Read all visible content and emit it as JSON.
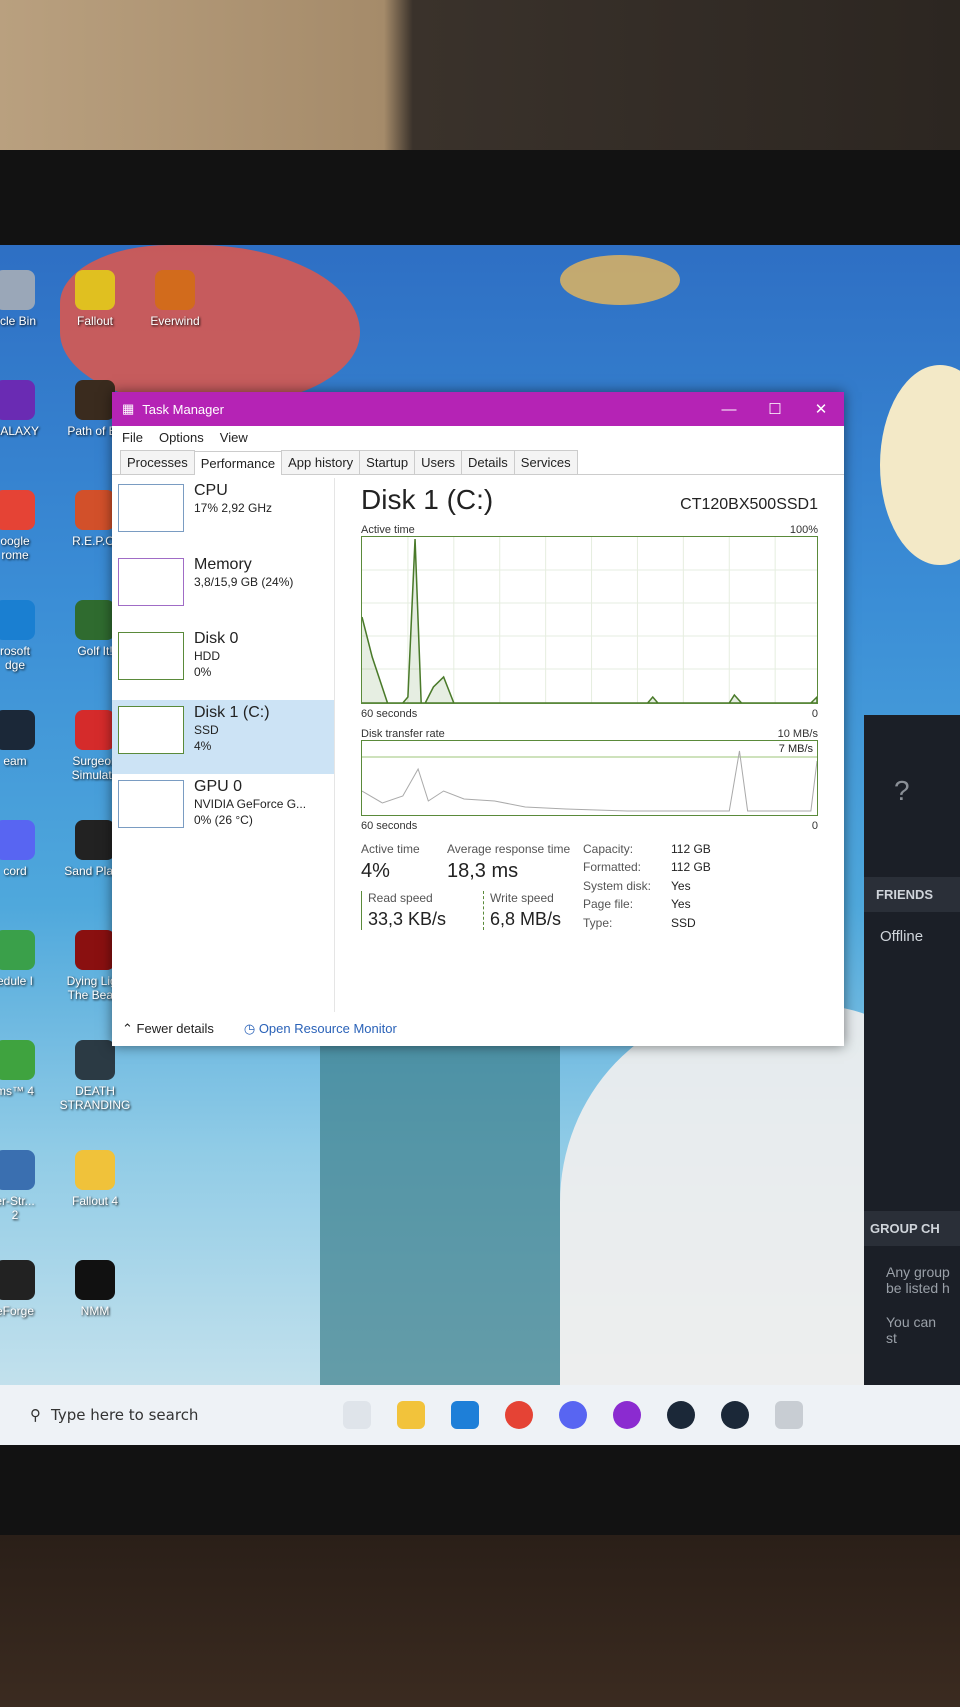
{
  "desktop_icons": [
    {
      "label": "ycle Bin",
      "color": "#9aa7b8"
    },
    {
      "label": "Fallout",
      "color": "#e0c020"
    },
    {
      "label": "Everwind",
      "color": "#d26b1c"
    },
    {
      "label": "GALAXY",
      "color": "#6a2bb3"
    },
    {
      "label": "Path of Ex",
      "color": "#3a2b1e"
    },
    {
      "label": "oogle\nrome",
      "color": "#e54335"
    },
    {
      "label": "R.E.P.O.",
      "color": "#d2502a"
    },
    {
      "label": "rosoft\ndge",
      "color": "#1a7fd1"
    },
    {
      "label": "Golf It!",
      "color": "#2f6b2f"
    },
    {
      "label": "eam",
      "color": "#1b2838"
    },
    {
      "label": "Surgeon\nSimulato",
      "color": "#d52b2b"
    },
    {
      "label": "cord",
      "color": "#5865f2"
    },
    {
      "label": "Sand Playe",
      "color": "#222222"
    },
    {
      "label": "edule I",
      "color": "#3aa04a"
    },
    {
      "label": "Dying Ligh\nThe Beast",
      "color": "#8a1010"
    },
    {
      "label": "ms™ 4",
      "color": "#3fa33f"
    },
    {
      "label": "DEATH\nSTRANDING",
      "color": "#2b3a44"
    },
    {
      "label": "er-Str...\n2",
      "color": "#3a6fb0"
    },
    {
      "label": "Fallout 4",
      "color": "#f0c23a"
    },
    {
      "label": "eForge",
      "color": "#222222"
    },
    {
      "label": "NMM",
      "color": "#111111"
    }
  ],
  "task_manager": {
    "title": "Task Manager",
    "menu": [
      "File",
      "Options",
      "View"
    ],
    "tabs": [
      "Processes",
      "Performance",
      "App history",
      "Startup",
      "Users",
      "Details",
      "Services"
    ],
    "active_tab": "Performance",
    "resources": [
      {
        "name": "CPU",
        "line1": "17% 2,92 GHz",
        "line2": "",
        "selected": false
      },
      {
        "name": "Memory",
        "line1": "3,8/15,9 GB (24%)",
        "line2": "",
        "selected": false
      },
      {
        "name": "Disk 0",
        "line1": "HDD",
        "line2": "0%",
        "selected": false
      },
      {
        "name": "Disk 1 (C:)",
        "line1": "SSD",
        "line2": "4%",
        "selected": true
      },
      {
        "name": "GPU 0",
        "line1": "NVIDIA GeForce G...",
        "line2": "0% (26 °C)",
        "selected": false
      }
    ],
    "detail": {
      "title": "Disk 1 (C:)",
      "model": "CT120BX500SSD1",
      "graph1": {
        "label": "Active time",
        "max": "100%",
        "time": "60 seconds",
        "min": "0"
      },
      "graph2": {
        "label": "Disk transfer rate",
        "max": "10 MB/s",
        "inner": "7 MB/s",
        "time": "60 seconds",
        "min": "0"
      },
      "active_time_label": "Active time",
      "active_time": "4%",
      "avg_resp_label": "Average response time",
      "avg_resp": "18,3 ms",
      "read_label": "Read speed",
      "read": "33,3 KB/s",
      "write_label": "Write speed",
      "write": "6,8 MB/s",
      "props": [
        {
          "k": "Capacity:",
          "v": "112 GB"
        },
        {
          "k": "Formatted:",
          "v": "112 GB"
        },
        {
          "k": "System disk:",
          "v": "Yes"
        },
        {
          "k": "Page file:",
          "v": "Yes"
        },
        {
          "k": "Type:",
          "v": "SSD"
        }
      ]
    },
    "footer": {
      "fewer": "Fewer details",
      "monitor": "Open Resource Monitor"
    }
  },
  "steam_panel": {
    "friends": "FRIENDS",
    "status": "Offline",
    "group": "GROUP CH",
    "text1": "Any group\nbe listed h",
    "text2": "You can st"
  },
  "taskbar": {
    "search_placeholder": "Type here to search"
  }
}
